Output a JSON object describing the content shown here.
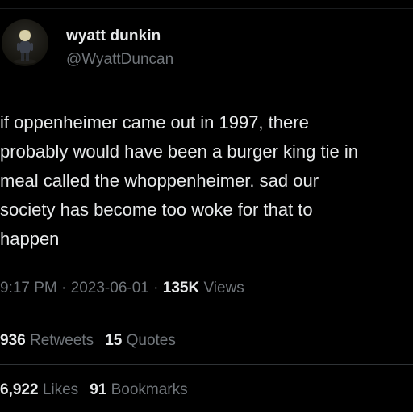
{
  "author": {
    "display_name": "wyatt dunkin",
    "handle": "@WyattDuncan",
    "avatar_icon": "profile-avatar"
  },
  "tweet": {
    "lines": [
      "if oppenheimer came out in 1997, there",
      "probably would have been a burger king tie in",
      "meal called the whoppenheimer. sad our",
      "society has become too woke for that to",
      "happen"
    ]
  },
  "meta": {
    "time": "9:17 PM",
    "sep1": " · ",
    "date": "2023-06-01",
    "sep2": " · ",
    "views_count": "135K",
    "views_label": " Views"
  },
  "engagement": {
    "retweets_count": "936",
    "retweets_label": " Retweets",
    "quotes_count": "15",
    "quotes_label": " Quotes",
    "likes_count": "6,922",
    "likes_label": " Likes",
    "bookmarks_count": "91",
    "bookmarks_label": " Bookmarks"
  },
  "colors": {
    "background": "#000000",
    "primary_text": "#e7e9ea",
    "secondary_text": "#71767b",
    "divider": "#2f3336"
  }
}
